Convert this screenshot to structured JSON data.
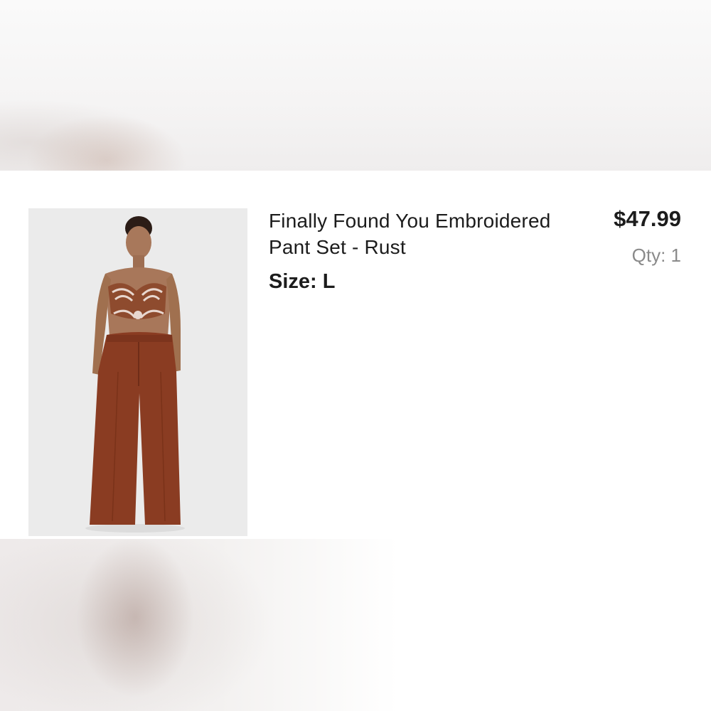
{
  "item": {
    "title": "Finally Found You Embroidered Pant Set - Rust",
    "size_label": "Size:",
    "size_value": "L",
    "price": "$47.99",
    "quantity": "Qty: 1",
    "image_icon": "product-photo",
    "color_accent": "#8a3c22"
  }
}
